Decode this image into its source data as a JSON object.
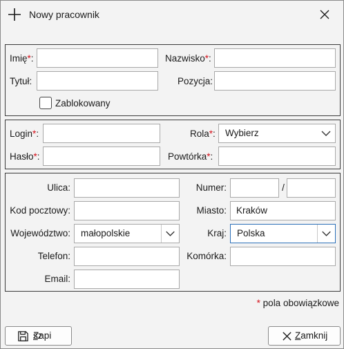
{
  "window": {
    "title": "Nowy pracownik"
  },
  "person": {
    "first_name_label": "Imię",
    "last_name_label": "Nazwisko",
    "title_label": "Tytuł",
    "position_label": "Pozycja",
    "blocked_label": "Zablokowany",
    "required_mark": "*",
    "label_suffix": ":",
    "first_name": "",
    "last_name": "",
    "title": "",
    "position": "",
    "blocked": false
  },
  "account": {
    "login_label": "Login",
    "role_label": "Rola",
    "password_label": "Hasło",
    "repeat_label": "Powtórka",
    "role_value": "Wybierz",
    "login": "",
    "password": "",
    "repeat": ""
  },
  "address": {
    "street_label": "Ulica:",
    "number_label": "Numer:",
    "number_separator": "/",
    "postal_label": "Kod pocztowy:",
    "city_label": "Miasto:",
    "city_value": "Kraków",
    "voivodeship_label": "Województwo:",
    "voivodeship_value": "małopolskie",
    "country_label": "Kraj:",
    "country_value": "Polska",
    "phone_label": "Telefon:",
    "mobile_label": "Komórka:",
    "email_label": "Email:"
  },
  "footer": {
    "required_note": "pola obowiązkowe",
    "required_mark": "*",
    "save_label_pre": "Zapi",
    "save_label_u": "s",
    "save_label_post": "z",
    "close_label_u": "Z",
    "close_label_post": "amknij"
  }
}
